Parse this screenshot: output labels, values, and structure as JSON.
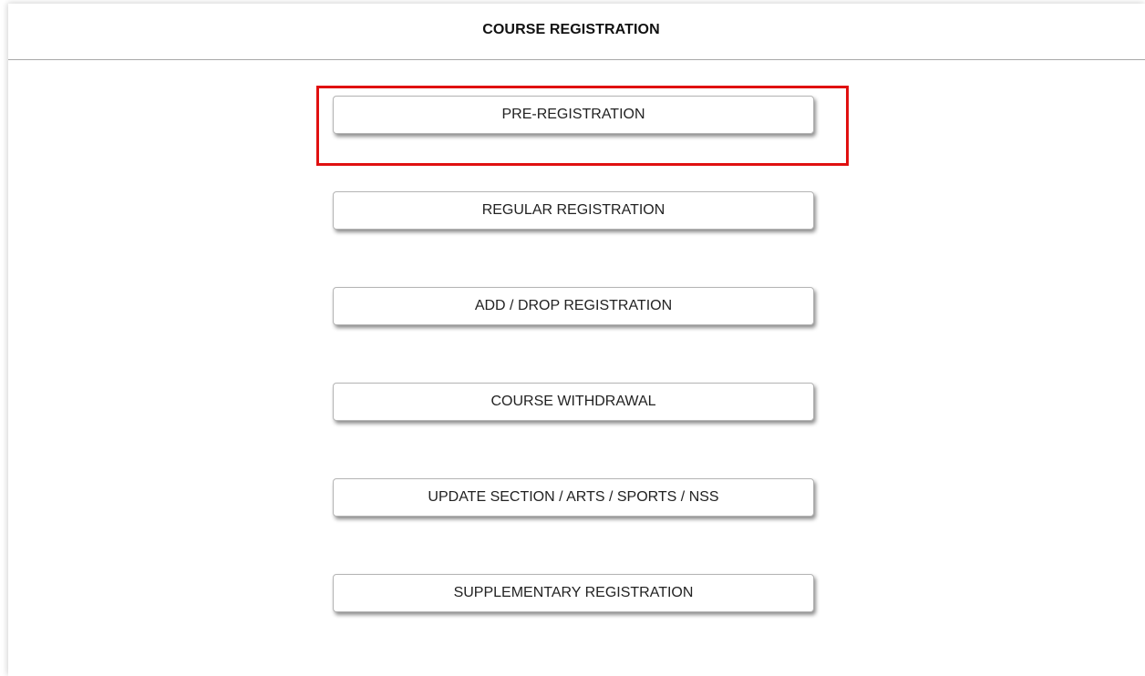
{
  "header": {
    "title": "COURSE REGISTRATION"
  },
  "buttons": [
    {
      "label": "PRE-REGISTRATION"
    },
    {
      "label": "REGULAR REGISTRATION"
    },
    {
      "label": "ADD / DROP REGISTRATION"
    },
    {
      "label": "COURSE WITHDRAWAL"
    },
    {
      "label": "UPDATE SECTION / ARTS / SPORTS / NSS"
    },
    {
      "label": "SUPPLEMENTARY REGISTRATION"
    }
  ],
  "colors": {
    "highlight": "#e01010",
    "border": "#b5b5b5",
    "text": "#222222"
  }
}
